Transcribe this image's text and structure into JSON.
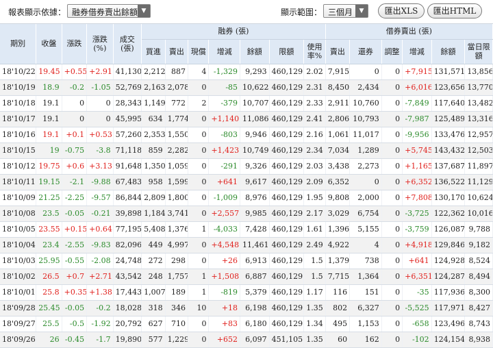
{
  "toolbar": {
    "basis_label": "報表顯示依據：",
    "basis_value": "融券借券賣出餘額",
    "range_label": "顯示範圍：",
    "range_value": "三個月",
    "xls_label": "匯出XLS",
    "html_label": "匯出HTML"
  },
  "colors": {
    "up": "#e0201c",
    "down": "#2a8a2a",
    "header_bg": "#dfe9f5"
  },
  "headers": {
    "date": "期別",
    "close": "收盤",
    "change": "漲跌",
    "change_pct": "漲跌(%)",
    "volume": "成交(張)",
    "group_margin": "融券 (張)",
    "group_lending": "借券賣出 (張)",
    "m_buy": "買進",
    "m_sell": "賣出",
    "m_spot": "現償",
    "m_delta": "增減",
    "m_balance": "餘額",
    "m_limit": "限額",
    "m_usage": "使用率%",
    "l_sell": "賣出",
    "l_return": "還券",
    "l_adjust": "調整",
    "l_delta": "增減",
    "l_balance": "餘額",
    "l_limit": "當日限額"
  },
  "rows": [
    [
      "18'10/22",
      "19.45",
      "+0.55",
      "+2.91",
      "41,130",
      "2,212",
      "887",
      "4",
      "-1,329",
      "9,293",
      "460,129",
      "2.02",
      "7,915",
      "0",
      "0",
      "+7,915",
      "131,571",
      "13,856"
    ],
    [
      "18'10/19",
      "18.9",
      "-0.2",
      "-1.05",
      "52,769",
      "2,163",
      "2,078",
      "0",
      "-85",
      "10,622",
      "460,129",
      "2.31",
      "8,450",
      "2,434",
      "0",
      "+6,016",
      "123,656",
      "13,770"
    ],
    [
      "18'10/18",
      "19.1",
      "0",
      "0",
      "28,343",
      "1,149",
      "772",
      "2",
      "-379",
      "10,707",
      "460,129",
      "2.33",
      "2,911",
      "10,760",
      "0",
      "-7,849",
      "117,640",
      "13,482"
    ],
    [
      "18'10/17",
      "19.1",
      "0",
      "0",
      "45,995",
      "634",
      "1,774",
      "0",
      "+1,140",
      "11,086",
      "460,129",
      "2.41",
      "2,806",
      "10,793",
      "0",
      "-7,987",
      "125,489",
      "13,316"
    ],
    [
      "18'10/16",
      "19.1",
      "+0.1",
      "+0.53",
      "57,260",
      "2,353",
      "1,550",
      "0",
      "-803",
      "9,946",
      "460,129",
      "2.16",
      "1,061",
      "11,017",
      "0",
      "-9,956",
      "133,476",
      "12,957"
    ],
    [
      "18'10/15",
      "19",
      "-0.75",
      "-3.8",
      "71,118",
      "859",
      "2,282",
      "0",
      "+1,423",
      "10,749",
      "460,129",
      "2.34",
      "7,034",
      "1,289",
      "0",
      "+5,745",
      "143,432",
      "12,503"
    ],
    [
      "18'10/12",
      "19.75",
      "+0.6",
      "+3.13",
      "91,648",
      "1,350",
      "1,059",
      "0",
      "-291",
      "9,326",
      "460,129",
      "2.03",
      "3,438",
      "2,273",
      "0",
      "+1,165",
      "137,687",
      "11,897"
    ],
    [
      "18'10/11",
      "19.15",
      "-2.1",
      "-9.88",
      "67,483",
      "958",
      "1,599",
      "0",
      "+641",
      "9,617",
      "460,129",
      "2.09",
      "6,352",
      "0",
      "0",
      "+6,352",
      "136,522",
      "11,129"
    ],
    [
      "18'10/09",
      "21.25",
      "-2.25",
      "-9.57",
      "86,844",
      "2,809",
      "1,800",
      "0",
      "-1,009",
      "8,976",
      "460,129",
      "1.95",
      "9,808",
      "2,000",
      "0",
      "+7,808",
      "130,170",
      "10,624"
    ],
    [
      "18'10/08",
      "23.5",
      "-0.05",
      "-0.21",
      "39,898",
      "1,184",
      "3,741",
      "0",
      "+2,557",
      "9,985",
      "460,129",
      "2.17",
      "3,029",
      "6,754",
      "0",
      "-3,725",
      "122,362",
      "10,016"
    ],
    [
      "18'10/05",
      "23.55",
      "+0.15",
      "+0.64",
      "77,195",
      "5,408",
      "1,376",
      "1",
      "-4,033",
      "7,428",
      "460,129",
      "1.61",
      "1,396",
      "5,155",
      "0",
      "-3,759",
      "126,087",
      "9,788"
    ],
    [
      "18'10/04",
      "23.4",
      "-2.55",
      "-9.83",
      "82,096",
      "449",
      "4,997",
      "0",
      "+4,548",
      "11,461",
      "460,129",
      "2.49",
      "4,922",
      "4",
      "0",
      "+4,918",
      "129,846",
      "9,182"
    ],
    [
      "18'10/03",
      "25.95",
      "-0.55",
      "-2.08",
      "24,748",
      "272",
      "298",
      "0",
      "+26",
      "6,913",
      "460,129",
      "1.5",
      "1,379",
      "738",
      "0",
      "+641",
      "124,928",
      "8,524"
    ],
    [
      "18'10/02",
      "26.5",
      "+0.7",
      "+2.71",
      "43,542",
      "248",
      "1,757",
      "1",
      "+1,508",
      "6,887",
      "460,129",
      "1.5",
      "7,715",
      "1,364",
      "0",
      "+6,351",
      "124,287",
      "8,494"
    ],
    [
      "18'10/01",
      "25.8",
      "+0.35",
      "+1.38",
      "17,443",
      "1,007",
      "189",
      "1",
      "-819",
      "5,379",
      "460,129",
      "1.17",
      "116",
      "151",
      "0",
      "-35",
      "117,936",
      "8,300"
    ],
    [
      "18'09/28",
      "25.45",
      "-0.05",
      "-0.2",
      "18,028",
      "318",
      "346",
      "10",
      "+18",
      "6,198",
      "460,129",
      "1.35",
      "802",
      "6,327",
      "0",
      "-5,525",
      "117,971",
      "8,427"
    ],
    [
      "18'09/27",
      "25.5",
      "-0.5",
      "-1.92",
      "20,792",
      "627",
      "710",
      "0",
      "+83",
      "6,180",
      "460,129",
      "1.34",
      "495",
      "1,153",
      "0",
      "-658",
      "123,496",
      "8,743"
    ],
    [
      "18'09/26",
      "26",
      "-0.45",
      "-1.7",
      "19,890",
      "577",
      "1,229",
      "0",
      "+652",
      "6,097",
      "451,105",
      "1.35",
      "60",
      "162",
      "0",
      "-102",
      "124,154",
      "8,938"
    ]
  ]
}
